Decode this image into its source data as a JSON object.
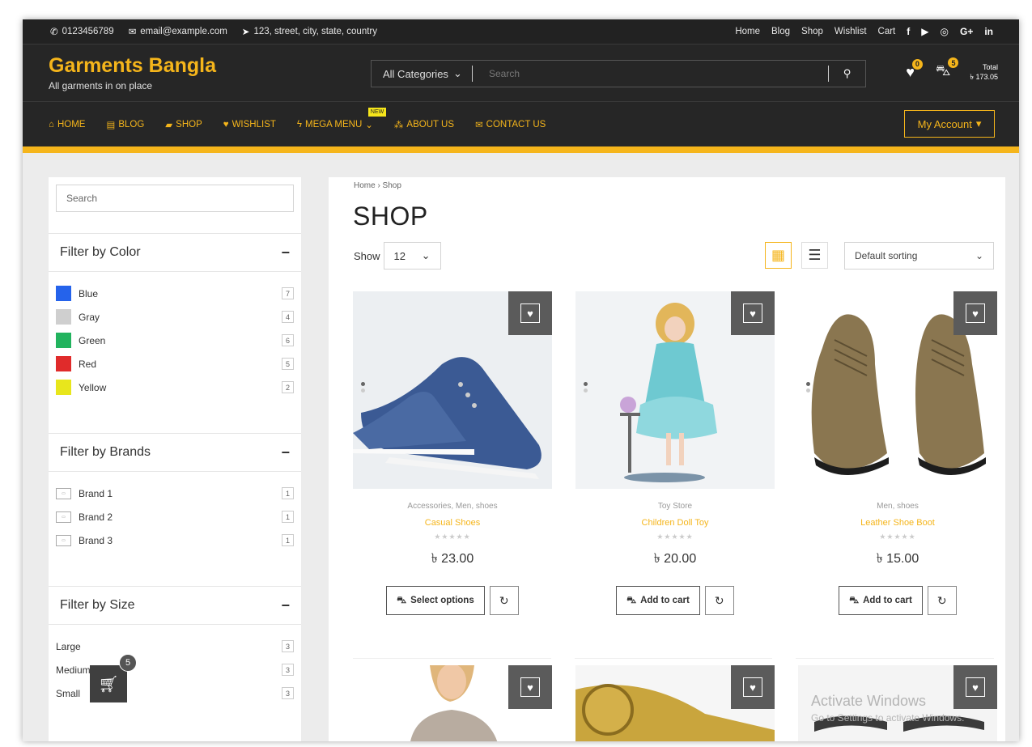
{
  "topbar": {
    "phone": "0123456789",
    "email": "email@example.com",
    "address": "123, street, city, state, country",
    "links": [
      "Home",
      "Blog",
      "Shop",
      "Wishlist",
      "Cart"
    ],
    "social": [
      "f",
      "G+",
      "in"
    ]
  },
  "header": {
    "brand": "Garments Bangla",
    "tagline": "All garments in on place",
    "category_select": "All Categories",
    "search_placeholder": "Search",
    "wishlist_count": "0",
    "cart_count": "5",
    "total_label": "Total",
    "total_value": "৳ 173.05"
  },
  "nav": {
    "items": [
      "HOME",
      "BLOG",
      "SHOP",
      "WISHLIST",
      "MEGA MENU",
      "ABOUT US",
      "CONTACT US"
    ],
    "new_badge": "NEW",
    "account": "My Account"
  },
  "sidebar": {
    "search_placeholder": "Search",
    "color_title": "Filter by Color",
    "colors": [
      {
        "label": "Blue",
        "count": "7",
        "color": "#2563eb"
      },
      {
        "label": "Gray",
        "count": "4",
        "color": "#cfcfcf"
      },
      {
        "label": "Green",
        "count": "6",
        "color": "#22b35e"
      },
      {
        "label": "Red",
        "count": "5",
        "color": "#e02b2b"
      },
      {
        "label": "Yellow",
        "count": "2",
        "color": "#e8e61c"
      }
    ],
    "brands_title": "Filter by Brands",
    "brands": [
      {
        "label": "Brand 1",
        "count": "1"
      },
      {
        "label": "Brand 2",
        "count": "1"
      },
      {
        "label": "Brand 3",
        "count": "1"
      }
    ],
    "size_title": "Filter by Size",
    "sizes": [
      {
        "label": "Large",
        "count": "3"
      },
      {
        "label": "Medium",
        "count": "3"
      },
      {
        "label": "Small",
        "count": "3"
      }
    ],
    "float_cart_count": "5"
  },
  "main": {
    "breadcrumb": "Home › Shop",
    "title": "SHOP",
    "show_label": "Show",
    "show_value": "12",
    "sort_value": "Default sorting",
    "products": [
      {
        "cats": "Accessories, Men, shoes",
        "name": "Casual Shoes",
        "price": "৳ 23.00",
        "button": "Select options"
      },
      {
        "cats": "Toy Store",
        "name": "Children Doll Toy",
        "price": "৳ 20.00",
        "button": "Add to cart"
      },
      {
        "cats": "Men, shoes",
        "name": "Leather Shoe Boot",
        "price": "৳ 15.00",
        "button": "Add to cart"
      }
    ]
  },
  "watermark": {
    "line1": "Activate Windows",
    "line2": "Go to Settings to activate Windows."
  }
}
